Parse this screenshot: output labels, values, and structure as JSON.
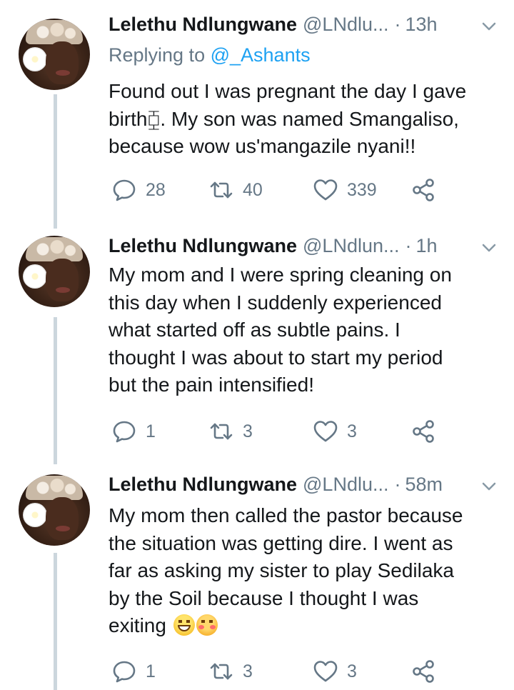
{
  "tweets": [
    {
      "name": "Lelethu Ndlungwane",
      "handle": "@LNdlu...",
      "dot": "·",
      "time": "13h",
      "replying_prefix": "Replying to",
      "replying_to": "@_Ashants",
      "lines": [
        "Found out I was pregnant the day I gave",
        "birth⧮. My son was named Smangaliso,",
        "because wow us'mangazile nyani!!"
      ],
      "replies": "28",
      "retweets": "40",
      "likes": "339"
    },
    {
      "name": "Lelethu Ndlungwane",
      "handle": "@LNdlun...",
      "dot": "·",
      "time": "1h",
      "lines": [
        "My mom and I were spring cleaning on",
        "this day when I suddenly experienced",
        "what started off as subtle pains. I",
        "thought I was about to start my period",
        "but the pain intensified!"
      ],
      "replies": "1",
      "retweets": "3",
      "likes": "3"
    },
    {
      "name": "Lelethu Ndlungwane",
      "handle": "@LNdlu...",
      "dot": "·",
      "time": "58m",
      "lines": [
        "My mom then called the pastor because",
        "the situation was getting dire. I went as",
        "far as asking my sister to play Sedilaka",
        "by the Soil because I thought I was",
        "exiting"
      ],
      "emojis": [
        "grinning-squinting-face-emoji",
        "flushed-face-emoji"
      ],
      "replies": "1",
      "retweets": "3",
      "likes": "3"
    }
  ],
  "icons": {
    "reply": "reply-bubble-icon",
    "retweet": "retweet-icon",
    "like": "heart-icon",
    "share": "share-icon",
    "menu": "chevron-down-icon"
  },
  "colors": {
    "text": "#14171a",
    "secondary": "#657786",
    "link": "#1da1f2",
    "thread_line": "#ccd6dd"
  }
}
